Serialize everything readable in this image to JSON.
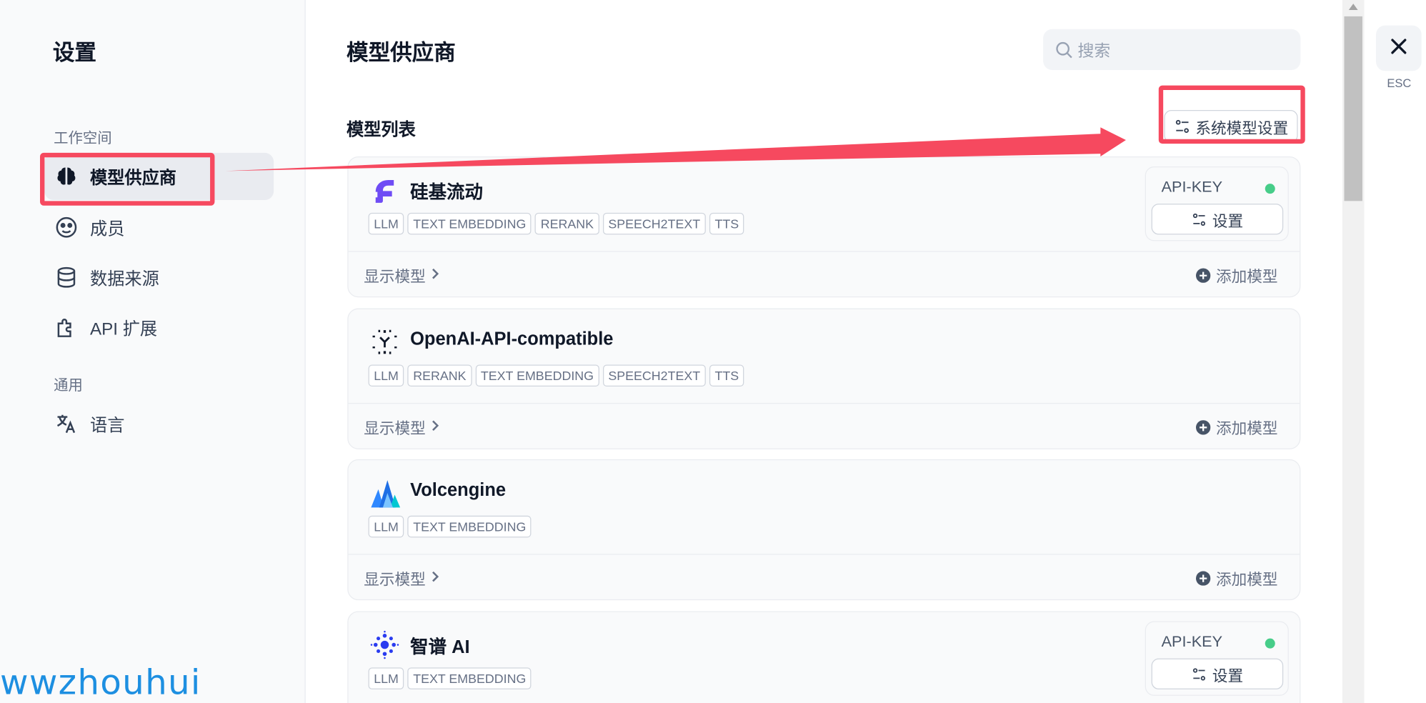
{
  "sidebar": {
    "title": "设置",
    "section_workspace": "工作空间",
    "section_general": "通用",
    "items": [
      {
        "label": "模型供应商",
        "icon": "brain-icon"
      },
      {
        "label": "成员",
        "icon": "members-icon"
      },
      {
        "label": "数据来源",
        "icon": "database-icon"
      },
      {
        "label": "API 扩展",
        "icon": "puzzle-icon"
      },
      {
        "label": "语言",
        "icon": "translate-icon"
      }
    ]
  },
  "header": {
    "title": "模型供应商",
    "search_placeholder": "搜索"
  },
  "list": {
    "title": "模型列表",
    "system_settings_label": "系统模型设置"
  },
  "providers": [
    {
      "name": "硅基流动",
      "tags": [
        "LLM",
        "TEXT EMBEDDING",
        "RERANK",
        "SPEECH2TEXT",
        "TTS"
      ],
      "show_models": "显示模型",
      "add_model": "添加模型",
      "api_key_label": "API-KEY",
      "settings_label": "设置"
    },
    {
      "name": "OpenAI-API-compatible",
      "tags": [
        "LLM",
        "RERANK",
        "TEXT EMBEDDING",
        "SPEECH2TEXT",
        "TTS"
      ],
      "show_models": "显示模型",
      "add_model": "添加模型"
    },
    {
      "name": "Volcengine",
      "tags": [
        "LLM",
        "TEXT EMBEDDING"
      ],
      "show_models": "显示模型",
      "add_model": "添加模型"
    },
    {
      "name": "智谱 AI",
      "tags": [
        "LLM",
        "TEXT EMBEDDING"
      ],
      "api_key_label": "API-KEY",
      "settings_label": "设置"
    }
  ],
  "close": {
    "esc_label": "ESC"
  },
  "watermark": "wwzhouhui",
  "colors": {
    "highlight": "#f6495f",
    "status_dot": "#47cd89",
    "watermark": "#1d8fe1"
  }
}
